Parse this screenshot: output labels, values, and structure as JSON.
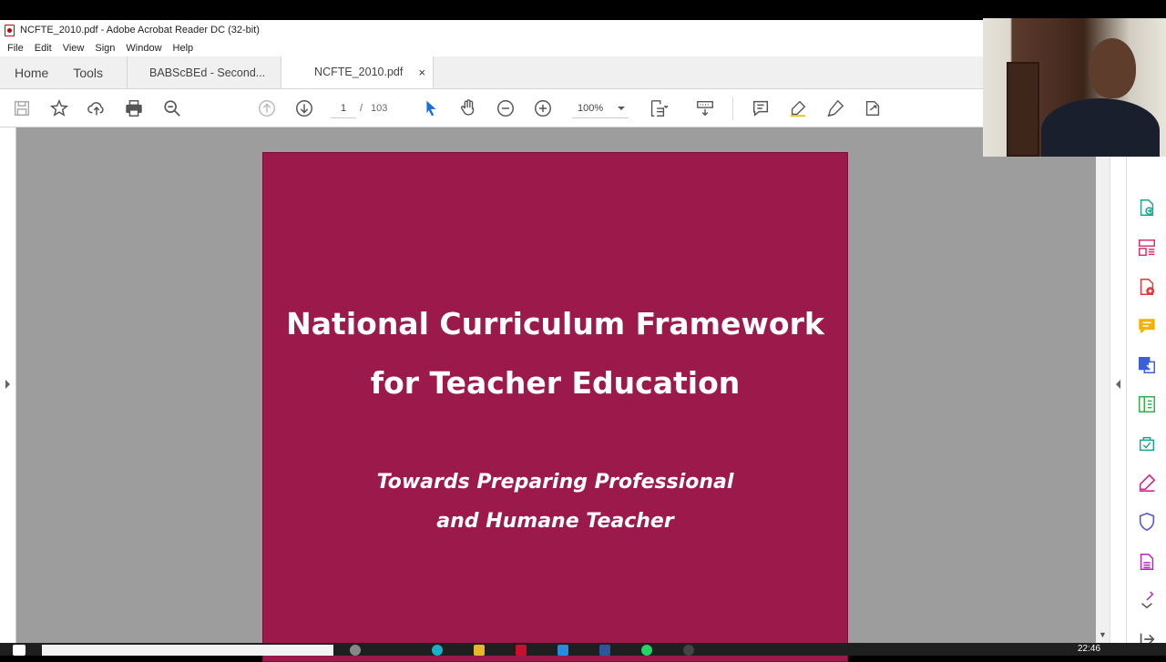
{
  "window": {
    "title": "NCFTE_2010.pdf - Adobe Acrobat Reader DC (32-bit)"
  },
  "menu": [
    "File",
    "Edit",
    "View",
    "Sign",
    "Window",
    "Help"
  ],
  "tabs": {
    "home": "Home",
    "tools": "Tools",
    "documents": [
      {
        "label": "BABScBEd - Second..."
      },
      {
        "label": "NCFTE_2010.pdf",
        "close": "×"
      }
    ]
  },
  "toolbar": {
    "page_current": "1",
    "page_separator": "/",
    "page_total": "103",
    "zoom": "100%",
    "icons": [
      "save-icon",
      "star-icon",
      "upload-icon",
      "print-icon",
      "search-icon",
      "page-up-icon",
      "page-down-icon",
      "select-arrow-icon",
      "hand-icon",
      "zoom-out-icon",
      "zoom-in-icon",
      "fit-page-icon",
      "scroll-mode-icon",
      "comment-icon",
      "highlight-icon",
      "sign-icon",
      "share-icon"
    ]
  },
  "document": {
    "title_line1": "National Curriculum Framework",
    "title_line2": "for Teacher Education",
    "subtitle_line1": "Towards Preparing Professional",
    "subtitle_line2": "and Humane Teacher",
    "cover_color": "#9c1a4b"
  },
  "right_panel": {
    "icons": [
      "export-pdf-icon",
      "organize-pages-icon",
      "create-pdf-icon",
      "comment-icon",
      "export-icon",
      "edit-pdf-icon",
      "fill-sign-icon",
      "highlight-pen-icon",
      "protect-icon",
      "document-icon",
      "more-tools-icon",
      "collapse-panel-icon"
    ]
  },
  "taskbar": {
    "clock": "22:46"
  }
}
